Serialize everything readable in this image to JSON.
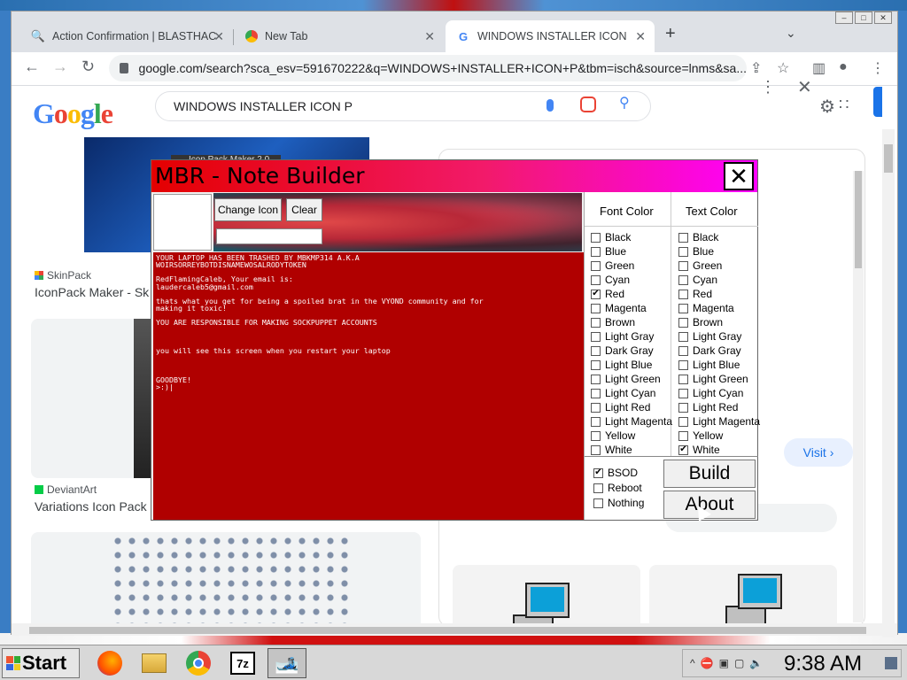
{
  "browser": {
    "tabs": [
      {
        "title": "Action Confirmation | BLASTHAC",
        "icon": "blasthack-icon"
      },
      {
        "title": "New Tab",
        "icon": "chrome-icon"
      },
      {
        "title": "WINDOWS INSTALLER ICON P - ",
        "icon": "google-icon"
      }
    ],
    "url": "google.com/search?sca_esv=591670222&q=WINDOWS+INSTALLER+ICON+P&tbm=isch&source=lnms&sa..."
  },
  "google": {
    "logo_letters": [
      "G",
      "o",
      "o",
      "g",
      "l",
      "e"
    ],
    "query": "WINDOWS INSTALLER ICON P",
    "results": [
      {
        "source": "SkinPack",
        "title": "IconPack Maker - Sk"
      },
      {
        "source": "DeviantArt",
        "title": "Variations Icon Pack"
      }
    ],
    "thumb_tag": "Icon Pack Maker 2.0",
    "visit_label": "Visit ›"
  },
  "mbr": {
    "title": "MBR - Note Builder",
    "close_glyph": "✕",
    "change_icon_label": "Change Icon",
    "clear_label": "Clear",
    "note_lines": [
      "YOUR LAPTOP HAS BEEN TRASHED BY MBKMP314 A.K.A",
      "WOIRSORREYBOTDISNAMEWOSALRODYTOKEN",
      "",
      "RedFlamingCaleb, Your email is:",
      "laudercaleb5@gmail.com",
      "",
      "thats what you get for being a spoiled brat in the VYOND community and for",
      "making it toxic!",
      "",
      "YOU ARE RESPONSIBLE FOR MAKING SOCKPUPPET ACCOUNTS",
      "",
      "",
      "",
      "you will see this screen when you restart your laptop",
      "",
      "",
      "",
      "GOODBYE!",
      ">:)|"
    ],
    "font_color_header": "Font Color",
    "text_color_header": "Text Color",
    "colors": [
      "Black",
      "Blue",
      "Green",
      "Cyan",
      "Red",
      "Magenta",
      "Brown",
      "Light Gray",
      "Dark Gray",
      "Light Blue",
      "Light Green",
      "Light Cyan",
      "Light Red",
      "Light Magenta",
      "Yellow",
      "White"
    ],
    "font_color_selected": "Red",
    "text_color_selected": "White",
    "options": [
      {
        "label": "BSOD",
        "checked": true
      },
      {
        "label": "Reboot",
        "checked": false
      },
      {
        "label": "Nothing",
        "checked": false
      }
    ],
    "build_label": "Build",
    "about_label": "About"
  },
  "taskbar": {
    "start_label": "Start",
    "apps": [
      "firefox-icon",
      "file-explorer-icon",
      "chrome-icon",
      "7zip-icon",
      "mbr-builder-icon"
    ],
    "clock": "9:38 AM"
  }
}
